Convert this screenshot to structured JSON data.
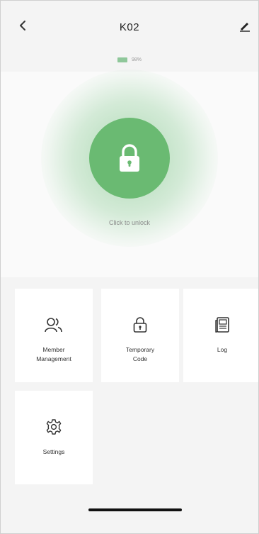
{
  "header": {
    "title": "K02",
    "back_icon": "chevron-left-icon",
    "edit_icon": "pencil-icon"
  },
  "status": {
    "battery_text": "98%",
    "battery_color": "#8fc79a"
  },
  "unlock": {
    "label": "Click to unlock",
    "icon": "padlock-icon",
    "accent_color": "#6aba72"
  },
  "menu": {
    "member_management": {
      "label": "Member\nManagement",
      "icon": "members-icon"
    },
    "temporary_code": {
      "label": "Temporary\nCode",
      "icon": "lock-code-icon"
    },
    "log": {
      "label": "Log",
      "icon": "log-icon"
    },
    "settings": {
      "label": "Settings",
      "icon": "gear-icon"
    }
  }
}
